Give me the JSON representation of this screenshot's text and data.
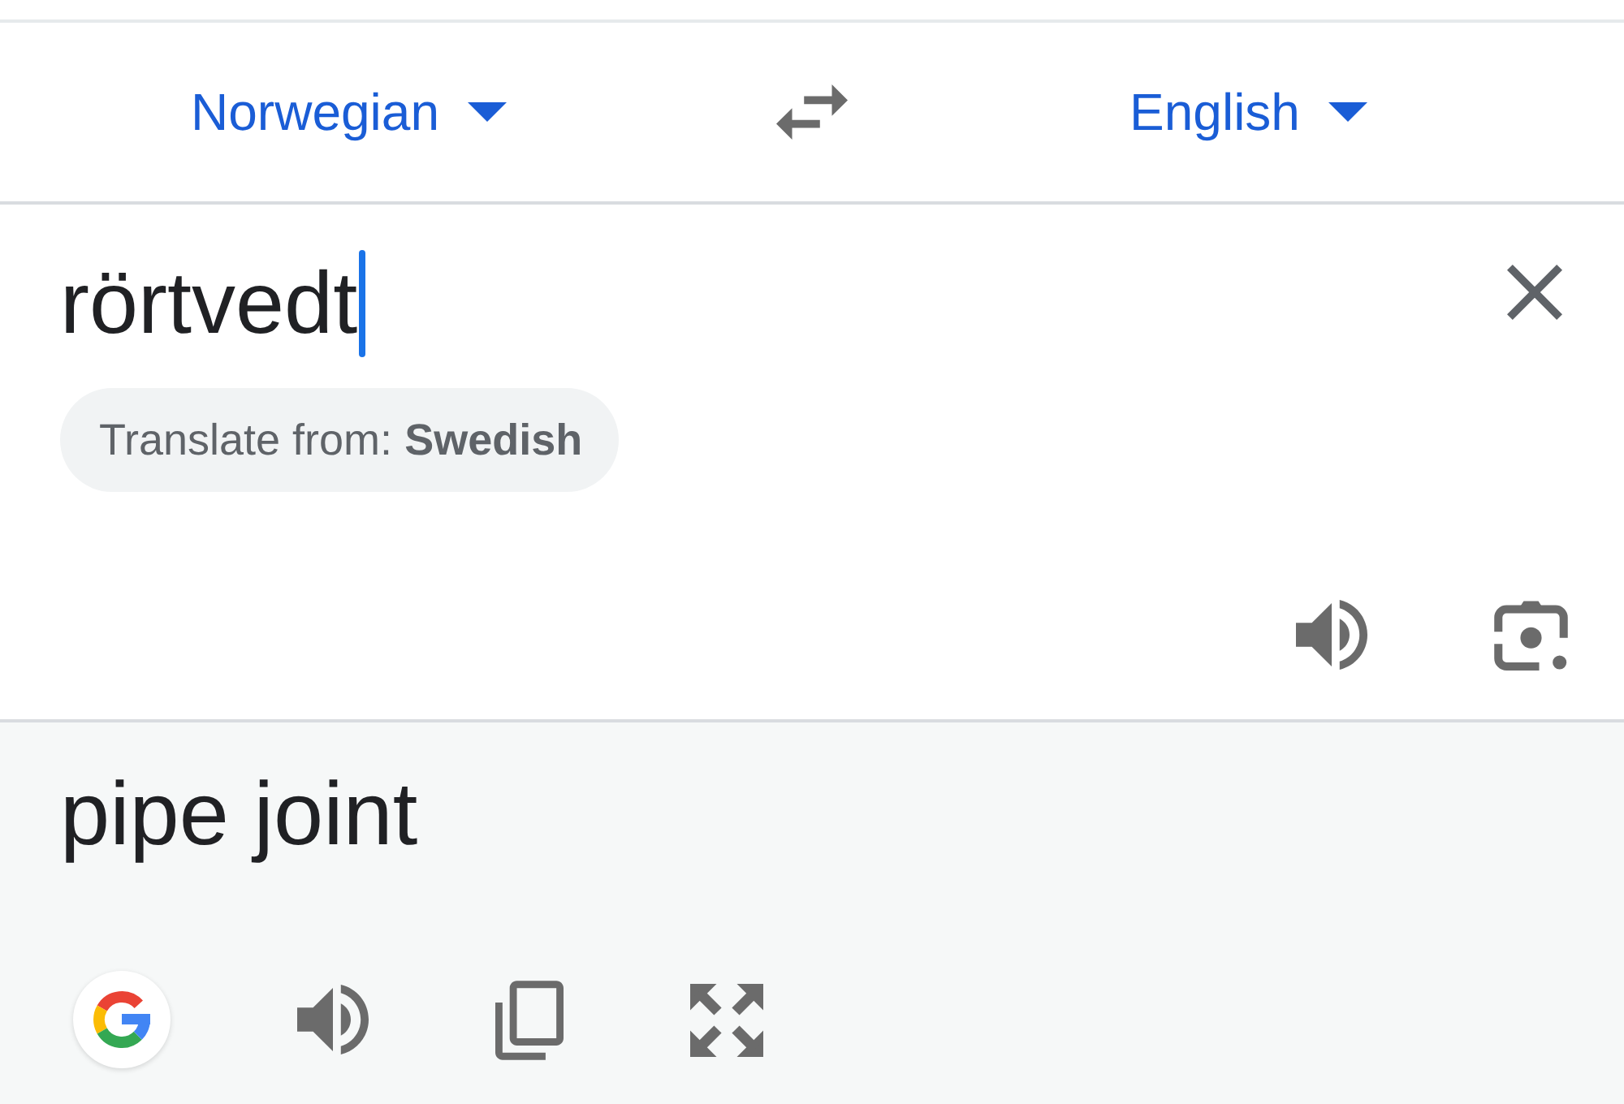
{
  "language_bar": {
    "source_language": "Norwegian",
    "target_language": "English"
  },
  "input": {
    "value": "rörtvedt",
    "focused": true
  },
  "language_suggestion": {
    "text": "Translate from: **Swedish**"
  },
  "output": {
    "text": "pipe joint"
  }
}
